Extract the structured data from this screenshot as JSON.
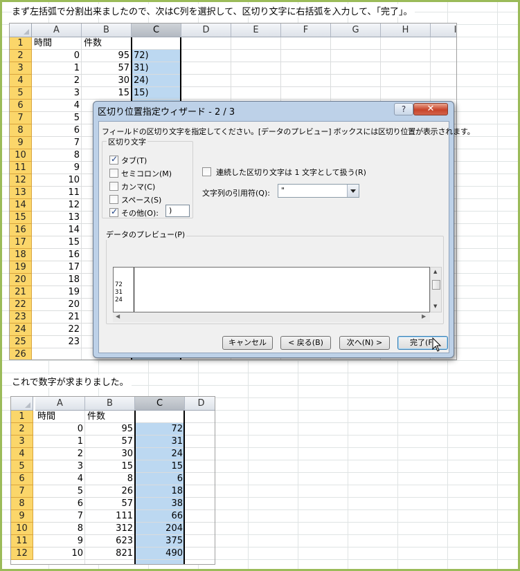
{
  "caption_top": "まず左括弧で分割出来ましたので、次はC列を選択して、区切り文字に右括弧を入力して、「完了」。",
  "caption_mid": "これで数字が求まりました。",
  "sheet1": {
    "columns": [
      "A",
      "B",
      "C",
      "D",
      "E",
      "F",
      "G",
      "H",
      "I"
    ],
    "rows": [
      "1",
      "2",
      "3",
      "4",
      "5",
      "6",
      "7",
      "8",
      "9",
      "10",
      "11",
      "12",
      "13",
      "14",
      "15",
      "16",
      "17",
      "18",
      "19",
      "20",
      "21",
      "22",
      "23",
      "24",
      "25",
      "26"
    ],
    "header_a": "時間",
    "header_b": "件数",
    "col_a": [
      "0",
      "1",
      "2",
      "3",
      "4",
      "5",
      "6",
      "7",
      "8",
      "9",
      "10",
      "11",
      "12",
      "13",
      "14",
      "15",
      "16",
      "17",
      "18",
      "19",
      "20",
      "21",
      "22",
      "23"
    ],
    "col_b": [
      "95",
      "57",
      "30",
      "15"
    ],
    "col_c": [
      "72)",
      "31)",
      "24)",
      "15)"
    ]
  },
  "dialog": {
    "title": "区切り位置指定ウィザード - 2 / 3",
    "help_label": "?",
    "close_label": "✕",
    "instruction": "フィールドの区切り文字を指定してください。[データのプレビュー] ボックスには区切り位置が表示されます。",
    "delim_group_title": "区切り文字",
    "options": [
      {
        "label": "タブ(T)",
        "checked": true
      },
      {
        "label": "セミコロン(M)",
        "checked": false
      },
      {
        "label": "カンマ(C)",
        "checked": false
      },
      {
        "label": "スペース(S)",
        "checked": false
      },
      {
        "label": "その他(O):",
        "checked": true
      }
    ],
    "other_value": ")",
    "consecutive_label": "連続した区切り文字は 1 文字として扱う(R)",
    "consecutive_checked": false,
    "qualifier_label": "文字列の引用符(Q):",
    "qualifier_value": "\"",
    "preview_title": "データのプレビュー(P)",
    "preview_lines": [
      "72",
      "31",
      "24"
    ],
    "buttons": {
      "cancel": "キャンセル",
      "back": "< 戻る(B)",
      "next": "次へ(N) >",
      "finish": "完了(F)"
    }
  },
  "sheet2": {
    "columns": [
      "A",
      "B",
      "C",
      "D"
    ],
    "rows": [
      "1",
      "2",
      "3",
      "4",
      "5",
      "6",
      "7",
      "8",
      "9",
      "10",
      "11",
      "12"
    ],
    "header_a": "時間",
    "header_b": "件数",
    "col_a": [
      "0",
      "1",
      "2",
      "3",
      "4",
      "5",
      "6",
      "7",
      "8",
      "9",
      "10"
    ],
    "col_b": [
      "95",
      "57",
      "30",
      "15",
      "8",
      "26",
      "57",
      "111",
      "312",
      "623",
      "821"
    ],
    "col_c": [
      "72",
      "31",
      "24",
      "15",
      "6",
      "18",
      "38",
      "66",
      "204",
      "375",
      "490"
    ]
  },
  "colors": {
    "frame": "#9bbb59",
    "row_header": "#fbd66a",
    "selected_column": "#bcd8f1",
    "dialog_frame": "#bdd1e8"
  }
}
